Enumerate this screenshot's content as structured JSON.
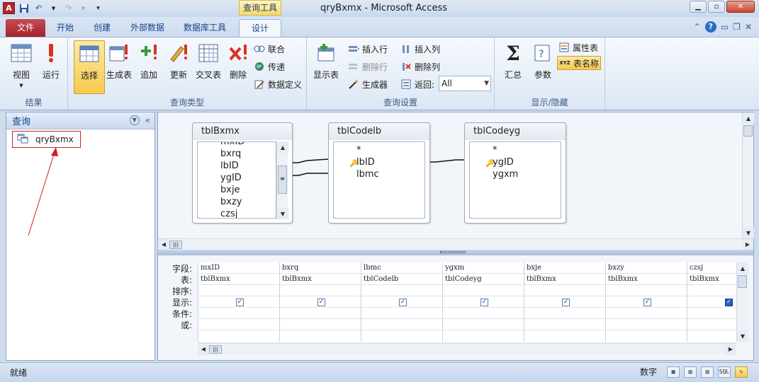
{
  "window": {
    "title": "qryBxmx  -  Microsoft Access",
    "context_tab_label": "查询工具"
  },
  "tabs": [
    "文件",
    "开始",
    "创建",
    "外部数据",
    "数据库工具",
    "设计"
  ],
  "ribbon": {
    "results": {
      "label": "结果",
      "view": "视图",
      "run": "运行"
    },
    "query_type": {
      "label": "查询类型",
      "select": "选择",
      "make_table": "生成表",
      "append": "追加",
      "update": "更新",
      "crosstab": "交叉表",
      "delete": "删除",
      "union": "联合",
      "pass_through": "传递",
      "data_definition": "数据定义"
    },
    "query_setup": {
      "label": "查询设置",
      "show_table": "显示表",
      "insert_rows": "插入行",
      "delete_rows": "删除行",
      "builder": "生成器",
      "insert_columns": "插入列",
      "delete_columns": "删除列",
      "return_label": "返回:",
      "return_value": "All"
    },
    "show_hide": {
      "label": "显示/隐藏",
      "totals": "汇总",
      "parameters": "参数",
      "property_sheet": "属性表",
      "table_names": "表名称"
    }
  },
  "nav": {
    "header": "查询",
    "items": [
      {
        "label": "qryBxmx"
      }
    ]
  },
  "tables": [
    {
      "name": "tblBxmx",
      "fields": [
        "mxID",
        "bxrq",
        "lbID",
        "ygID",
        "bxje",
        "bxzy",
        "czsj"
      ]
    },
    {
      "name": "tblCodelb",
      "fields": [
        "*",
        "lbID",
        "lbmc"
      ]
    },
    {
      "name": "tblCodeyg",
      "fields": [
        "*",
        "ygID",
        "ygxm"
      ]
    }
  ],
  "grid": {
    "row_labels": [
      "字段:",
      "表:",
      "排序:",
      "显示:",
      "条件:",
      "或:"
    ],
    "columns": [
      {
        "field": "mxID",
        "table": "tblBxmx",
        "show": true
      },
      {
        "field": "bxrq",
        "table": "tblBxmx",
        "show": true
      },
      {
        "field": "lbmc",
        "table": "tblCodelb",
        "show": true
      },
      {
        "field": "ygxm",
        "table": "tblCodeyg",
        "show": true
      },
      {
        "field": "bxje",
        "table": "tblBxmx",
        "show": true
      },
      {
        "field": "bxzy",
        "table": "tblBxmx",
        "show": true
      },
      {
        "field": "czsj",
        "table": "tblBxmx",
        "show": true
      }
    ]
  },
  "status": {
    "left": "就绪",
    "mode": "数字",
    "sql": "SQL"
  },
  "colors": {
    "file_tab": "#b7333a",
    "highlight": "#f8c94e",
    "annotation": "#d02020"
  }
}
